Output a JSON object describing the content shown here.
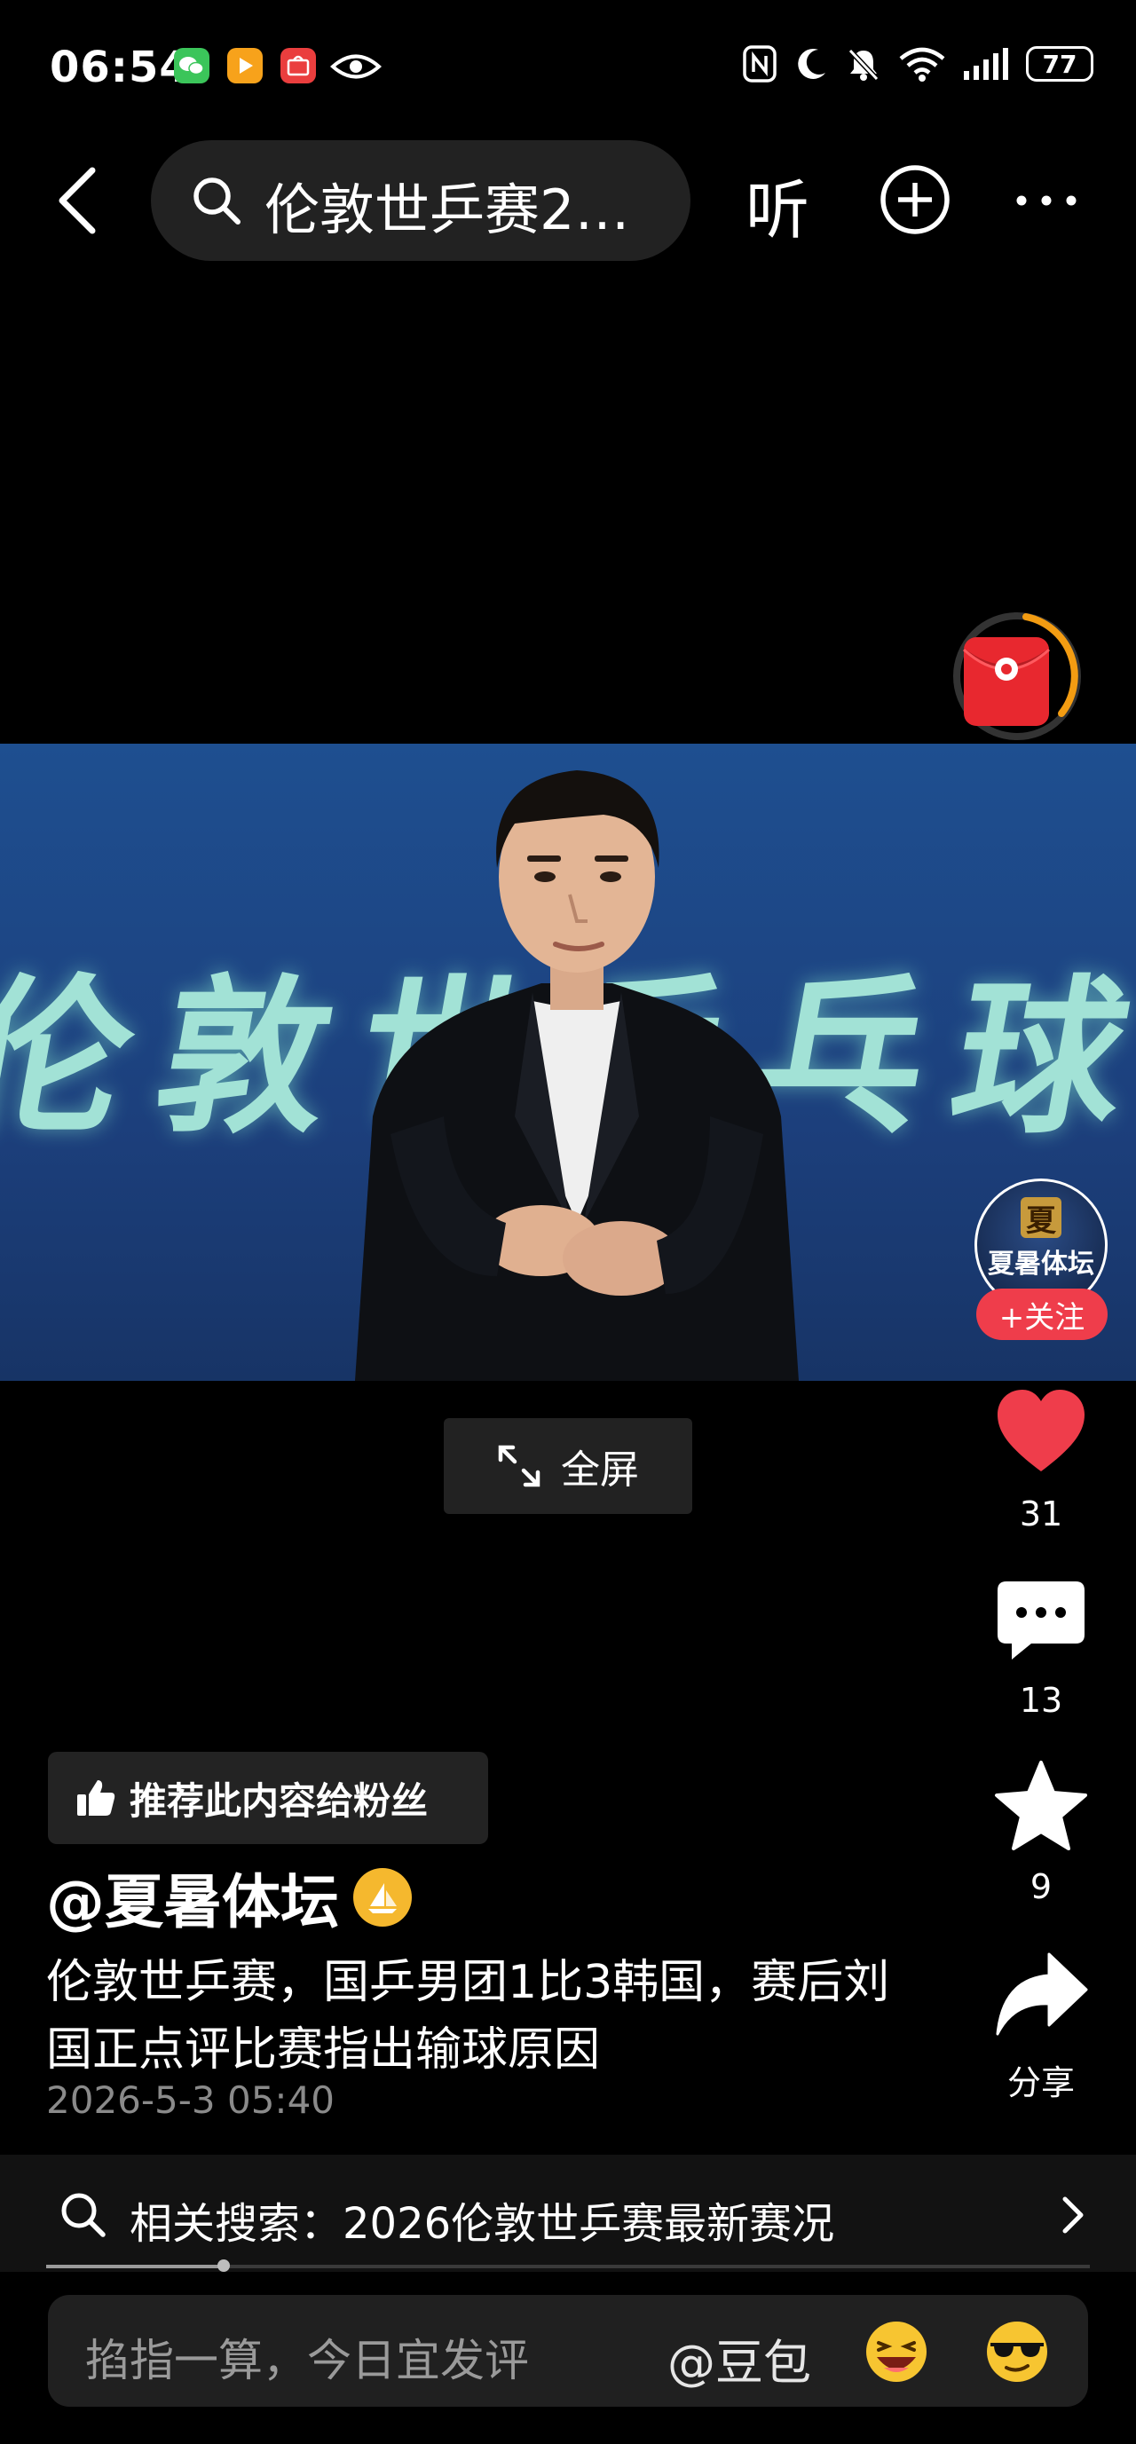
{
  "status_bar": {
    "time": "06:54",
    "battery": "77",
    "icons": [
      "nfc-icon",
      "moon-icon",
      "bell-off-icon",
      "wifi-icon",
      "signal-icon",
      "battery-icon"
    ]
  },
  "nav": {
    "search_text": "伦敦世乒赛2…",
    "listen_label": "听"
  },
  "video": {
    "banner_text": "伦敦世乒乓球团",
    "fullscreen_label": "全屏"
  },
  "author_panel": {
    "avatar_char": "夏",
    "avatar_name": "夏暑体坛",
    "follow_label": "+关注"
  },
  "actions": {
    "likes": "31",
    "comments": "13",
    "favorites": "9",
    "share_label": "分享"
  },
  "post": {
    "recommend_label": "推荐此内容给粉丝",
    "author": "@夏暑体坛",
    "description": "伦敦世乒赛，国乒男团1比3韩国，赛后刘国正点评比赛指出输球原因",
    "date": "2026-5-3 05:40"
  },
  "related": {
    "text": "相关搜索：2026伦敦世乒赛最新赛况",
    "progress": 0.17
  },
  "comment_bar": {
    "placeholder": "掐指一算，今日宜发评",
    "mention": "@豆包"
  },
  "colors": {
    "like_red": "#ef3d4b",
    "follow_red": "#ef3d4b",
    "badge_gold": "#f5b82e",
    "banner_mint": "#aef0de"
  }
}
